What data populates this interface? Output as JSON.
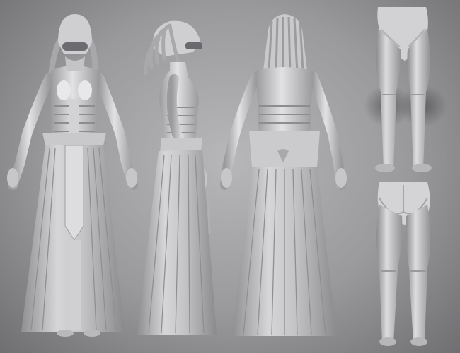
{
  "scene": {
    "views": [
      {
        "name": "front-view"
      },
      {
        "name": "side-view"
      },
      {
        "name": "back-view"
      },
      {
        "name": "legs-front-view"
      },
      {
        "name": "legs-back-view"
      }
    ],
    "colors": {
      "background_center": "#b7b7b9",
      "background_edge": "#6f6f72",
      "model_light": "#e4e4e6",
      "model_mid": "#bdbdbf",
      "model_dark": "#8e8e91",
      "shadow": "#5a5a5e"
    }
  }
}
